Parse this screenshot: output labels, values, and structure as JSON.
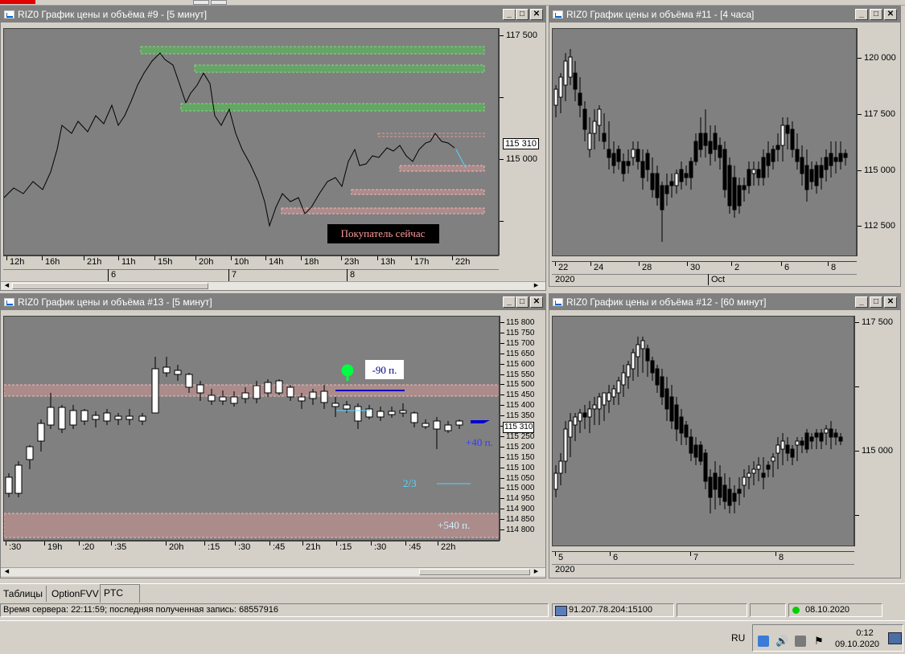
{
  "windows": {
    "w9": {
      "title": "RIZ0 График цены и объёма #9 - [5 минут]",
      "y_labels": [
        "117 500",
        "115 000"
      ],
      "price_tag": "115 310",
      "x_labels": [
        "12h",
        "16h",
        "21h",
        "11h",
        "15h",
        "20h",
        "10h",
        "14h",
        "18h",
        "23h",
        "13h",
        "17h",
        "22h"
      ],
      "date_labels": [
        "6",
        "7",
        "8"
      ],
      "annotation": "Покупатель сейчас"
    },
    "w11": {
      "title": "RIZ0 График цены и объёма #11 - [4 часа]",
      "y_labels": [
        "120 000",
        "117 500",
        "115 000",
        "112 500"
      ],
      "x_labels": [
        "22",
        "24",
        "28",
        "30",
        "2",
        "6",
        "8"
      ],
      "date_labels": [
        "2020",
        "Oct"
      ]
    },
    "w13": {
      "title": "RIZ0 График цены и объёма #13 - [5 минут]",
      "y_labels": [
        "115 800",
        "115 750",
        "115 700",
        "115 650",
        "115 600",
        "115 550",
        "115 500",
        "115 450",
        "115 400",
        "115 350",
        "115 310",
        "115 250",
        "115 200",
        "115 150",
        "115 100",
        "115 050",
        "115 000",
        "114 950",
        "114 900",
        "114 850",
        "114 800"
      ],
      "x_labels": [
        ":30",
        "19h",
        ":20",
        ":35",
        "20h",
        ":15",
        ":30",
        ":45",
        "21h",
        ":15",
        ":30",
        ":45",
        "22h"
      ],
      "label_loss": "-90 п.",
      "label_plus40": "+40 п.",
      "label_ratio": "2/3",
      "label_plus540": "+540 п."
    },
    "w12": {
      "title": "RIZ0 График цены и объёма #12 - [60 минут]",
      "y_labels": [
        "117 500",
        "115 000"
      ],
      "x_labels": [
        "5",
        "6",
        "7",
        "8"
      ],
      "date_labels": [
        "2020"
      ]
    }
  },
  "tabs": [
    "Таблицы",
    "OptionFVV",
    "PTC"
  ],
  "status": {
    "server": "Время сервера: 22:11:59; последняя полученная запись: 68557916",
    "connection": "91.207.78.204:15100",
    "date": "08.10.2020"
  },
  "taskbar": {
    "lang": "RU",
    "time": "0:12",
    "date": "09.10.2020"
  },
  "colors": {
    "plot_bg": "#808080",
    "resistance_zone": "#4ec24e",
    "support_zone": "#e39a9a",
    "marker": "#00ff40"
  }
}
